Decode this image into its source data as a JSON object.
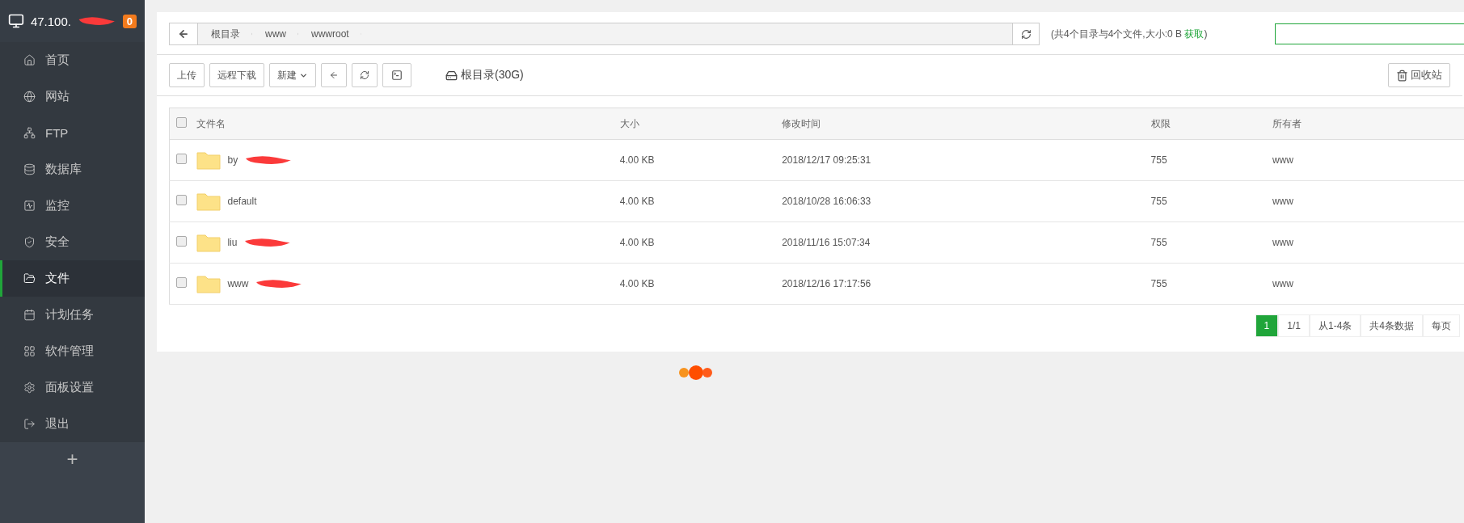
{
  "sidebar": {
    "host": "47.100.",
    "host_redacted": true,
    "badge": "0",
    "items": [
      {
        "label": "首页",
        "selected": false
      },
      {
        "label": "网站",
        "selected": false
      },
      {
        "label": "FTP",
        "selected": false
      },
      {
        "label": "数据库",
        "selected": false
      },
      {
        "label": "监控",
        "selected": false
      },
      {
        "label": "安全",
        "selected": false
      },
      {
        "label": "文件",
        "selected": true
      },
      {
        "label": "计划任务",
        "selected": false
      },
      {
        "label": "软件管理",
        "selected": false
      },
      {
        "label": "面板设置",
        "selected": false
      },
      {
        "label": "退出",
        "selected": false
      }
    ],
    "add_button": "+"
  },
  "breadcrumb": [
    "根目录",
    "www",
    "wwwroot"
  ],
  "summary": {
    "before": "(共4个目录与4个文件,大小:0 B",
    "link": "获取",
    "after": ")"
  },
  "toolbar": {
    "buttons": [
      {
        "label": "上传",
        "kind": "text"
      },
      {
        "label": "远程下载",
        "kind": "text"
      },
      {
        "label": "新建",
        "kind": "dropdown"
      },
      {
        "kind": "back"
      },
      {
        "kind": "refresh"
      },
      {
        "kind": "terminal"
      }
    ],
    "disk": "根目录(30G)",
    "recycle": "回收站"
  },
  "table": {
    "select_all_checked": false,
    "columns": [
      "文件名",
      "大小",
      "修改时间",
      "权限",
      "所有者"
    ],
    "rows": [
      {
        "name": "by",
        "redacted": true,
        "size": "4.00 KB",
        "time": "2018/12/17 09:25:31",
        "perm": "755",
        "owner": "www",
        "checked": false
      },
      {
        "name": "default",
        "redacted": false,
        "size": "4.00 KB",
        "time": "2018/10/28 16:06:33",
        "perm": "755",
        "owner": "www",
        "checked": false
      },
      {
        "name": "liu",
        "redacted": true,
        "size": "4.00 KB",
        "time": "2018/11/16 15:07:34",
        "perm": "755",
        "owner": "www",
        "checked": false
      },
      {
        "name": "www",
        "redacted": true,
        "size": "4.00 KB",
        "time": "2018/12/16 17:17:56",
        "perm": "755",
        "owner": "www",
        "checked": false
      }
    ]
  },
  "pagination": [
    {
      "label": "1",
      "selected": true
    },
    {
      "label": "1/1",
      "selected": false
    },
    {
      "label": "从1-4条",
      "selected": false
    },
    {
      "label": "共4条数据",
      "selected": false
    },
    {
      "label": "每页",
      "selected": false
    }
  ]
}
